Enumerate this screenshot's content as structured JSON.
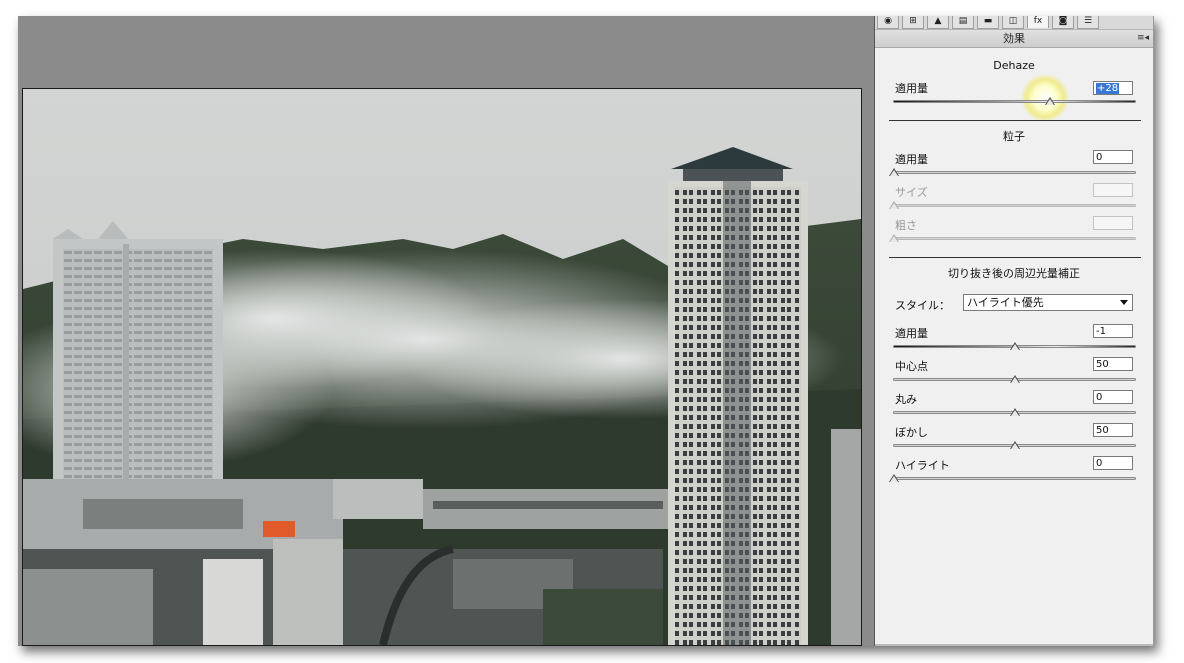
{
  "panel": {
    "tabs": [
      "◉",
      "⊞",
      "▲",
      "▤",
      "▬",
      "◫",
      "fx",
      "◙",
      "☰"
    ],
    "section_title": "効果",
    "menu_icon": "≡◂",
    "dehaze": {
      "title": "Dehaze",
      "amount_label": "適用量",
      "amount_value": "+28",
      "amount_fraction": 0.64
    },
    "grain": {
      "title": "粒子",
      "amount_label": "適用量",
      "amount_value": "0",
      "size_label": "サイズ",
      "size_value": "",
      "roughness_label": "粗さ",
      "roughness_value": ""
    },
    "vignette": {
      "title": "切り抜き後の周辺光量補正",
      "style_label": "スタイル：",
      "style_value": "ハイライト優先",
      "amount_label": "適用量",
      "amount_value": "-1",
      "midpoint_label": "中心点",
      "midpoint_value": "50",
      "roundness_label": "丸み",
      "roundness_value": "0",
      "feather_label": "ぼかし",
      "feather_value": "50",
      "highlights_label": "ハイライト",
      "highlights_value": "0"
    }
  },
  "colors": {
    "canvas_bg": "#8b8b8b",
    "panel_bg": "#f0f0f0",
    "selection": "#3b78d6",
    "highlight_glow": "#f0e63c"
  }
}
